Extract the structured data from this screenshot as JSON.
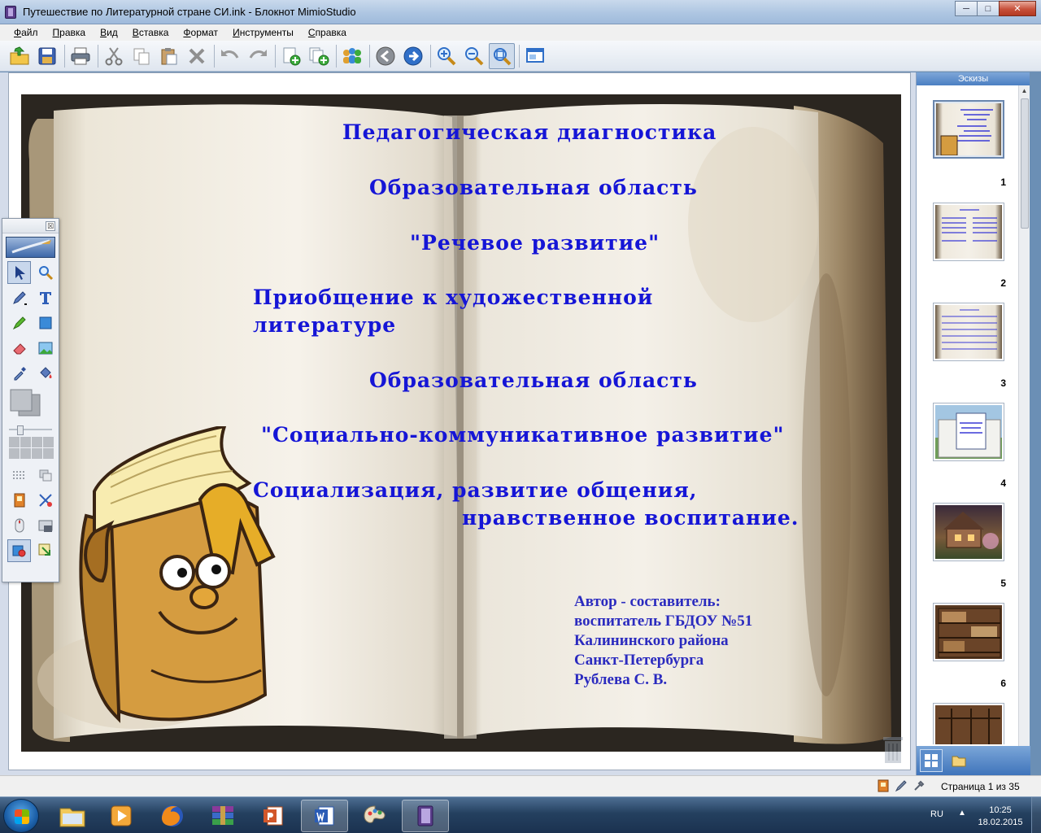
{
  "window": {
    "title": "Путешествие по Литературной стране СИ.ink - Блокнот MimioStudio",
    "minimize": "─",
    "maximize": "□",
    "close": "✕"
  },
  "menu": [
    "Файл",
    "Правка",
    "Вид",
    "Вставка",
    "Формат",
    "Инструменты",
    "Справка"
  ],
  "toolbar_icons": [
    "open-icon",
    "save-icon",
    "print-icon",
    "cut-icon",
    "copy-icon",
    "paste-icon",
    "delete-icon",
    "undo-icon",
    "redo-icon",
    "new-page-icon",
    "duplicate-page-icon",
    "collaborate-icon",
    "previous-page-icon",
    "next-page-icon",
    "zoom-in-icon",
    "zoom-out-icon",
    "zoom-fit-icon",
    "screen-icon"
  ],
  "slide": {
    "line1": "Педагогическая диагностика",
    "line2": "Образовательная область",
    "line3": "\"Речевое развитие\"",
    "line4a": "Приобщение к художественной",
    "line4b": "литературе",
    "line5": "Образовательная область",
    "line6": "\"Социально-коммуникативное развитие\"",
    "line7a": "Социализация, развитие общения,",
    "line7b": "нравственное воспитание.",
    "author": [
      "Автор - составитель:",
      "воспитатель ГБДОУ №51",
      "Калининского района",
      "Санкт-Петербурга",
      "Рублева С. В."
    ]
  },
  "palette": {
    "close": "☒"
  },
  "sidebar": {
    "title": "Эскизы",
    "thumbnails": [
      {
        "number": "1",
        "selected": true
      },
      {
        "number": "2",
        "selected": false
      },
      {
        "number": "3",
        "selected": false
      },
      {
        "number": "4",
        "selected": false
      },
      {
        "number": "5",
        "selected": false
      },
      {
        "number": "6",
        "selected": false
      }
    ]
  },
  "status": {
    "page_text": "Страница 1 из 35"
  },
  "taskbar": {
    "lang": "RU",
    "time": "10:25",
    "date": "18.02.2015"
  },
  "colors": {
    "slide_text": "#1515d6",
    "author_text": "#2b2bbf"
  }
}
